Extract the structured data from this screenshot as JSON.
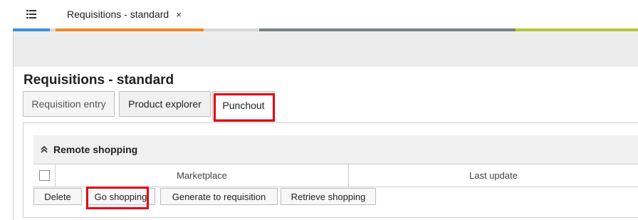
{
  "top_tabs": [
    {
      "label": "Requisitions - standard",
      "close_glyph": "×",
      "active": true
    }
  ],
  "menu_icon": "list-menu-icon",
  "page": {
    "title": "Requisitions - standard"
  },
  "sub_tabs": [
    {
      "label": "Requisition entry",
      "active": false
    },
    {
      "label": "Product explorer",
      "active": false
    },
    {
      "label": "Punchout",
      "active": true
    }
  ],
  "section": {
    "title": "Remote shopping",
    "collapse_glyph": "≈"
  },
  "grid": {
    "columns": [
      "Marketplace",
      "Last update"
    ],
    "select_all_checked": false
  },
  "actions": [
    "Delete",
    "Go shopping",
    "Generate to requisition",
    "Retrieve shopping"
  ],
  "colors": {
    "highlight": "#e0000f",
    "stripe_blue": "#3a8fd6",
    "stripe_orange": "#f08a24",
    "stripe_gray": "#7a8183",
    "stripe_green": "#b5c734"
  }
}
